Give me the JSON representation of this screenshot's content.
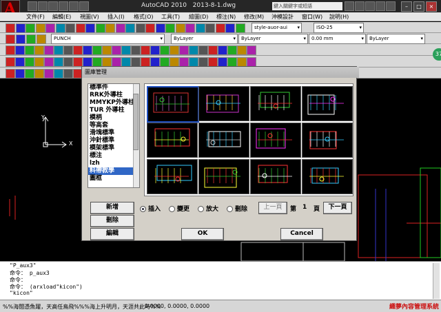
{
  "window": {
    "app_title": "AutoCAD 2010",
    "file_name": "2013-8-1.dwg",
    "search_placeholder": "鍵入關鍵字或短語"
  },
  "menubar": {
    "items": [
      "文件(F)",
      "編輯(E)",
      "視圖(V)",
      "插入(I)",
      "格式(O)",
      "工具(T)",
      "繪圖(D)",
      "標注(N)",
      "修改(M)",
      "沖模設計",
      "窗口(W)",
      "說明(H)"
    ]
  },
  "toolbar": {
    "text_style": "style-auor-aui",
    "dim_style": "ISO-25",
    "layer_name": "PUNCH",
    "color": "ByLayer",
    "linetype": "ByLayer",
    "lineweight": "0.00 mm",
    "plot_style": "ByLayer",
    "side_badge": "37"
  },
  "dialog": {
    "title": "圖庫管理",
    "list_items": [
      "標準件",
      "RRK外導柱",
      "MMYKP外導柱",
      "TUR 外導柱",
      "模柄",
      "等高套",
      "滑塊標準",
      "沖針標準",
      "模架標準",
      "標注",
      "lzh",
      "料帶教學",
      "圖框"
    ],
    "selected_index": 11,
    "buttons": {
      "add": "新增",
      "delete": "刪除",
      "edit": "編輯",
      "prev_page": "上一頁",
      "next_page": "下一頁",
      "ok": "OK",
      "cancel": "Cancel"
    },
    "radios": [
      {
        "label": "插入",
        "checked": true
      },
      {
        "label": "變更",
        "checked": false
      },
      {
        "label": "放大",
        "checked": false
      },
      {
        "label": "刪除",
        "checked": false
      }
    ],
    "page_prefix": "第",
    "page_number": "1",
    "page_suffix": "頁",
    "selected_thumbnail": 0
  },
  "ucs": {
    "x_label": "X",
    "y_label": "Y"
  },
  "command": {
    "lines": [
      "\"P_aux3\"",
      "命令： p_aux3",
      "命令：",
      "命令： (arxload\"kicon\")",
      "\"kicon\""
    ]
  },
  "status": {
    "marquee": "%%海闊憑魚躍，天高任鳥飛%%%海上升明月，天涯共此時%%",
    "coords": "0.0000, 0.0000, 0.0000"
  },
  "watermark": "織夢內容管理系統"
}
